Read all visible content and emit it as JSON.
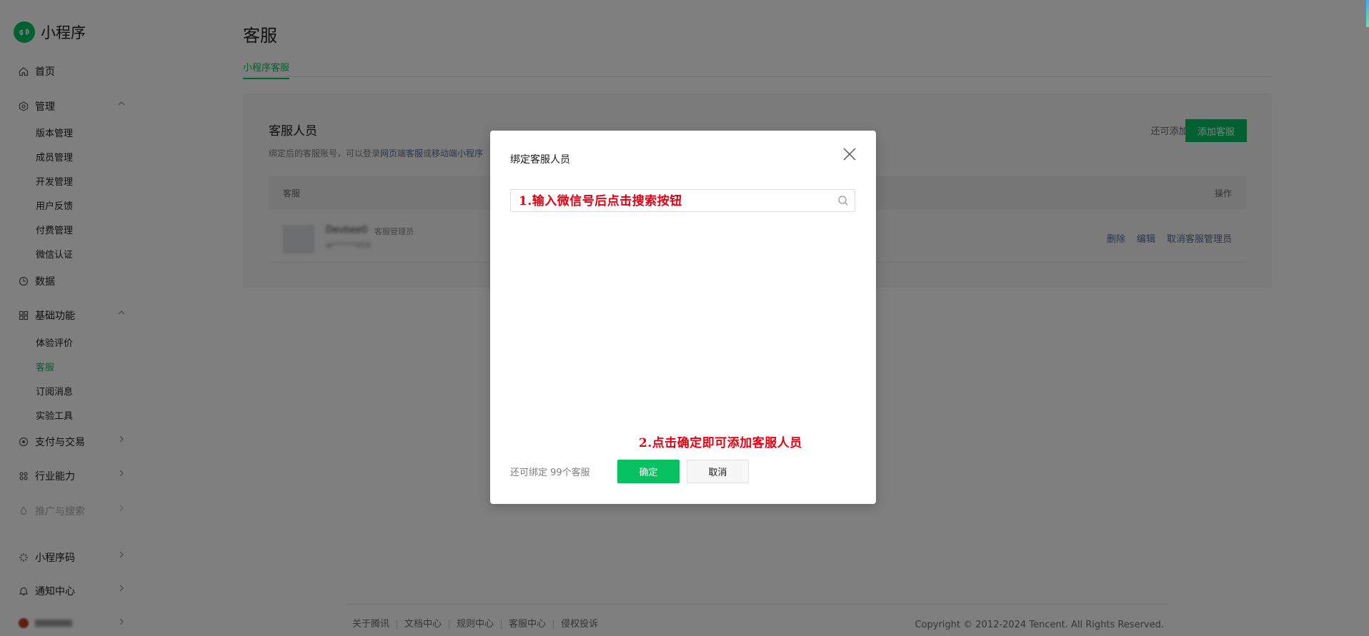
{
  "app": {
    "name": "小程序"
  },
  "sidebar": {
    "items": [
      {
        "label": "首页",
        "icon": "home-icon"
      },
      {
        "label": "管理",
        "icon": "settings-hex-icon",
        "expanded": true,
        "children": [
          "版本管理",
          "成员管理",
          "开发管理",
          "用户反馈",
          "付费管理",
          "微信认证"
        ]
      },
      {
        "label": "数据",
        "icon": "clock-chart-icon"
      },
      {
        "label": "基础功能",
        "icon": "grid-icon",
        "expanded": true,
        "children": [
          "体验评价",
          "客服",
          "订阅消息",
          "实验工具"
        ]
      },
      {
        "label": "支付与交易",
        "icon": "payment-icon"
      },
      {
        "label": "行业能力",
        "icon": "industry-icon"
      },
      {
        "label": "推广与搜索",
        "icon": "promote-icon",
        "disabled": true
      },
      {
        "label": "小程序码",
        "icon": "code-icon"
      },
      {
        "label": "通知中心",
        "icon": "bell-icon"
      }
    ],
    "active_child": "客服"
  },
  "page": {
    "title": "客服",
    "tab": "小程序客服",
    "section_title": "客服人员",
    "desc_prefix": "绑定后的客服账号，可以登录",
    "desc_link1": "网页端客服",
    "desc_mid": "或",
    "desc_link2": "移动端小程序",
    "remain_text": "还可添加99个",
    "add_button": "添加客服",
    "table": {
      "col_left": "客服",
      "col_right": "操作",
      "row": {
        "name": "Devbee0",
        "role": "客服管理员",
        "id": "w******004",
        "actions": [
          "删除",
          "编辑",
          "取消客服管理员"
        ]
      }
    }
  },
  "footer": {
    "links": [
      "关于腾讯",
      "文档中心",
      "规则中心",
      "客服中心",
      "侵权投诉"
    ],
    "copyright": "Copyright © 2012-2024 Tencent. All Rights Reserved."
  },
  "dialog": {
    "title": "绑定客服人员",
    "search_value": "",
    "annotation_1": "1.输入微信号后点击搜索按钮",
    "annotation_2": "2.点击确定即可添加客服人员",
    "remain": "还可绑定 99个客服",
    "ok": "确定",
    "cancel": "取消"
  },
  "colors": {
    "brand": "#07c160",
    "link": "#576b95",
    "annotation": "#e60012"
  }
}
